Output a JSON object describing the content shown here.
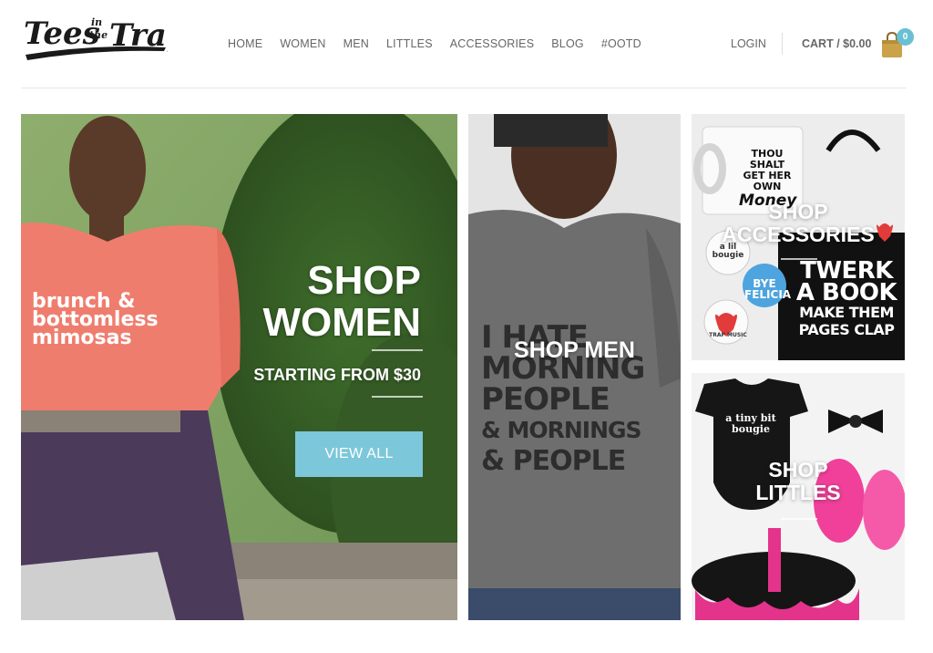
{
  "brand": {
    "logo_text": "Tees in the Trap"
  },
  "nav": {
    "items": [
      "HOME",
      "WOMEN",
      "MEN",
      "LITTLES",
      "ACCESSORIES",
      "BLOG",
      "#OOTD"
    ]
  },
  "account": {
    "login_label": "LOGIN",
    "cart_label": "CART / $0.00",
    "cart_count": "0",
    "cart_icon": "shopping-bag-icon"
  },
  "tiles": {
    "women": {
      "title_line1": "SHOP",
      "title_line2": "WOMEN",
      "subtitle": "STARTING FROM $30",
      "button_label": "VIEW ALL",
      "shirt_print": [
        "brunch &",
        "bottomless",
        "mimosas"
      ]
    },
    "men": {
      "title": "SHOP MEN",
      "shirt_print": [
        "I HATE",
        "MORNING",
        "PEOPLE",
        "& MORNINGS",
        "& PEOPLE"
      ]
    },
    "accessories": {
      "title_line1": "SHOP",
      "title_line2": "ACCESSORIES",
      "mug_print": [
        "THOU SHALT",
        "GET HER OWN",
        "Money"
      ],
      "bag_print": [
        "TWERK",
        "A BOOK",
        "MAKE THEM",
        "PAGES CLAP"
      ],
      "buttons": [
        "a lil bougie",
        "BYE FELICIA",
        "TRAP MUSIC"
      ]
    },
    "littles": {
      "title_line1": "SHOP",
      "title_line2": "LITTLES",
      "onesie_print": [
        "a tiny bit",
        "bougie"
      ]
    }
  },
  "colors": {
    "accent": "#7cc7da",
    "badge": "#69c0d4",
    "nav_text": "#666666"
  }
}
